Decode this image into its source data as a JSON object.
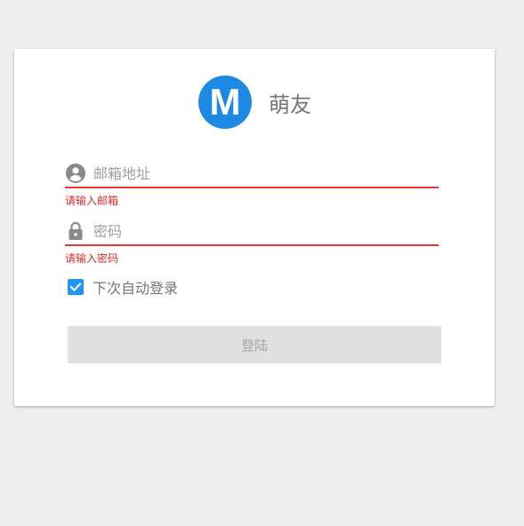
{
  "brand": {
    "logo_letter": "M",
    "logo_color": "#1e88e5",
    "name": "萌友"
  },
  "form": {
    "email": {
      "icon": "account-circle-icon",
      "placeholder": "邮箱地址",
      "value": "",
      "error": "请输入邮箱"
    },
    "password": {
      "icon": "lock-icon",
      "placeholder": "密码",
      "value": "",
      "error": "请输入密码"
    },
    "remember": {
      "label": "下次自动登录",
      "checked": true
    },
    "submit_label": "登陆"
  },
  "colors": {
    "accent": "#2196f3",
    "error": "#e53935",
    "disabled_bg": "#e0e0e0",
    "disabled_text": "#a6a6a6"
  }
}
